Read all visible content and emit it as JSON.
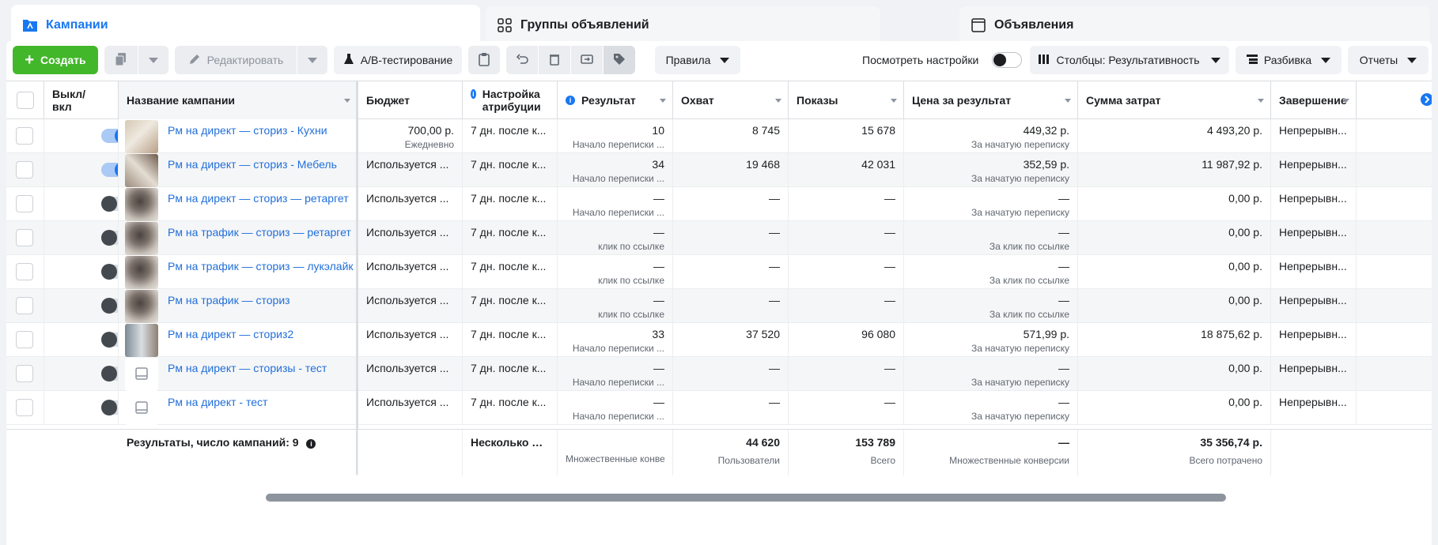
{
  "tabs": [
    {
      "label": "Кампании",
      "icon": "folder-icon"
    },
    {
      "label": "Группы объявлений",
      "icon": "grid-icon"
    },
    {
      "label": "Объявления",
      "icon": "ad-window-icon"
    }
  ],
  "toolbar": {
    "create": "Создать",
    "edit": "Редактировать",
    "ab_test": "A/B-тестирование",
    "rules": "Правила",
    "view_settings": "Посмотреть настройки",
    "columns": "Столбцы: Результативность",
    "breakdown": "Разбивка",
    "reports": "Отчеты"
  },
  "columns": {
    "toggle": "Выкл/\nвкл",
    "name": "Название кампании",
    "budget": "Бюджет",
    "attribution": "Настройка атрибуции",
    "result": "Результат",
    "reach": "Охват",
    "impressions": "Показы",
    "cost_per_result": "Цена за результат",
    "spent": "Сумма затрат",
    "end": "Завершение"
  },
  "rows": [
    {
      "on": true,
      "thumb": "kitchen",
      "name": "Рм на директ — сториз - Кухни",
      "budget": "700,00 р.",
      "budget_sub": "Ежедневно",
      "attr": "7 дн. после к...",
      "result": "10",
      "result_sub": "Начало переписки ...",
      "reach": "8 745",
      "impr": "15 678",
      "cpr": "449,32 р.",
      "cpr_sub": "За начатую переписку",
      "spent": "4 493,20 р.",
      "end": "Непрерывн..."
    },
    {
      "on": true,
      "thumb": "furn",
      "name": "Рм на директ — сториз - Мебель",
      "budget": "Используется ...",
      "budget_sub": "",
      "attr": "7 дн. после к...",
      "result": "34",
      "result_sub": "Начало переписки ...",
      "reach": "19 468",
      "impr": "42 031",
      "cpr": "352,59 р.",
      "cpr_sub": "За начатую переписку",
      "spent": "11 987,92 р.",
      "end": "Непрерывн..."
    },
    {
      "on": false,
      "thumb": "photo",
      "name": "Рм на директ — сториз — ретаргет",
      "budget": "Используется ...",
      "budget_sub": "",
      "attr": "7 дн. после к...",
      "result": "—",
      "result_sub": "Начало переписки ...",
      "reach": "—",
      "impr": "—",
      "cpr": "—",
      "cpr_sub": "За начатую переписку",
      "spent": "0,00 р.",
      "end": "Непрерывн..."
    },
    {
      "on": false,
      "thumb": "photo",
      "name": "Рм на трафик — сториз — ретаргет",
      "budget": "Используется ...",
      "budget_sub": "",
      "attr": "7 дн. после к...",
      "result": "—",
      "result_sub": "клик по ссылке",
      "reach": "—",
      "impr": "—",
      "cpr": "—",
      "cpr_sub": "За клик по ссылке",
      "spent": "0,00 р.",
      "end": "Непрерывн..."
    },
    {
      "on": false,
      "thumb": "photo",
      "name": "Рм на трафик — сториз — лукэлайк",
      "budget": "Используется ...",
      "budget_sub": "",
      "attr": "7 дн. после к...",
      "result": "—",
      "result_sub": "клик по ссылке",
      "reach": "—",
      "impr": "—",
      "cpr": "—",
      "cpr_sub": "За клик по ссылке",
      "spent": "0,00 р.",
      "end": "Непрерывн..."
    },
    {
      "on": false,
      "thumb": "photo",
      "name": "Рм на трафик — сториз",
      "budget": "Используется ...",
      "budget_sub": "",
      "attr": "7 дн. после к...",
      "result": "—",
      "result_sub": "клик по ссылке",
      "reach": "—",
      "impr": "—",
      "cpr": "—",
      "cpr_sub": "За клик по ссылке",
      "spent": "0,00 р.",
      "end": "Непрерывн..."
    },
    {
      "on": false,
      "thumb": "rooms",
      "name": "Рм на директ — сториз2",
      "budget": "Используется ...",
      "budget_sub": "",
      "attr": "7 дн. после к...",
      "result": "33",
      "result_sub": "Начало переписки ...",
      "reach": "37 520",
      "impr": "96 080",
      "cpr": "571,99 р.",
      "cpr_sub": "За начатую переписку",
      "spent": "18 875,62 р.",
      "end": "Непрерывн..."
    },
    {
      "on": false,
      "thumb": "ph",
      "name": "Рм на директ — сторизы - тест",
      "budget": "Используется ...",
      "budget_sub": "",
      "attr": "7 дн. после к...",
      "result": "—",
      "result_sub": "Начало переписки ...",
      "reach": "—",
      "impr": "—",
      "cpr": "—",
      "cpr_sub": "За начатую переписку",
      "spent": "0,00 р.",
      "end": "Непрерывн..."
    },
    {
      "on": false,
      "thumb": "ph",
      "name": "Рм на директ - тест",
      "budget": "Используется ...",
      "budget_sub": "",
      "attr": "7 дн. после к...",
      "result": "—",
      "result_sub": "Начало переписки ...",
      "reach": "—",
      "impr": "—",
      "cpr": "—",
      "cpr_sub": "За начатую переписку",
      "spent": "0,00 р.",
      "end": "Непрерывн..."
    }
  ],
  "footer": {
    "label": "Результаты, число кампаний: 9",
    "attr": "Несколько на...",
    "result_sub": "Множественные конве",
    "reach": "44 620",
    "reach_sub": "Пользователи",
    "impr": "153 789",
    "impr_sub": "Всего",
    "cpr": "—",
    "cpr_sub": "Множественные конверсии",
    "spent": "35 356,74 р.",
    "spent_sub": "Всего потрачено"
  },
  "colors": {
    "accent": "#1877f2",
    "create": "#42b72a",
    "link": "#216fdb"
  }
}
